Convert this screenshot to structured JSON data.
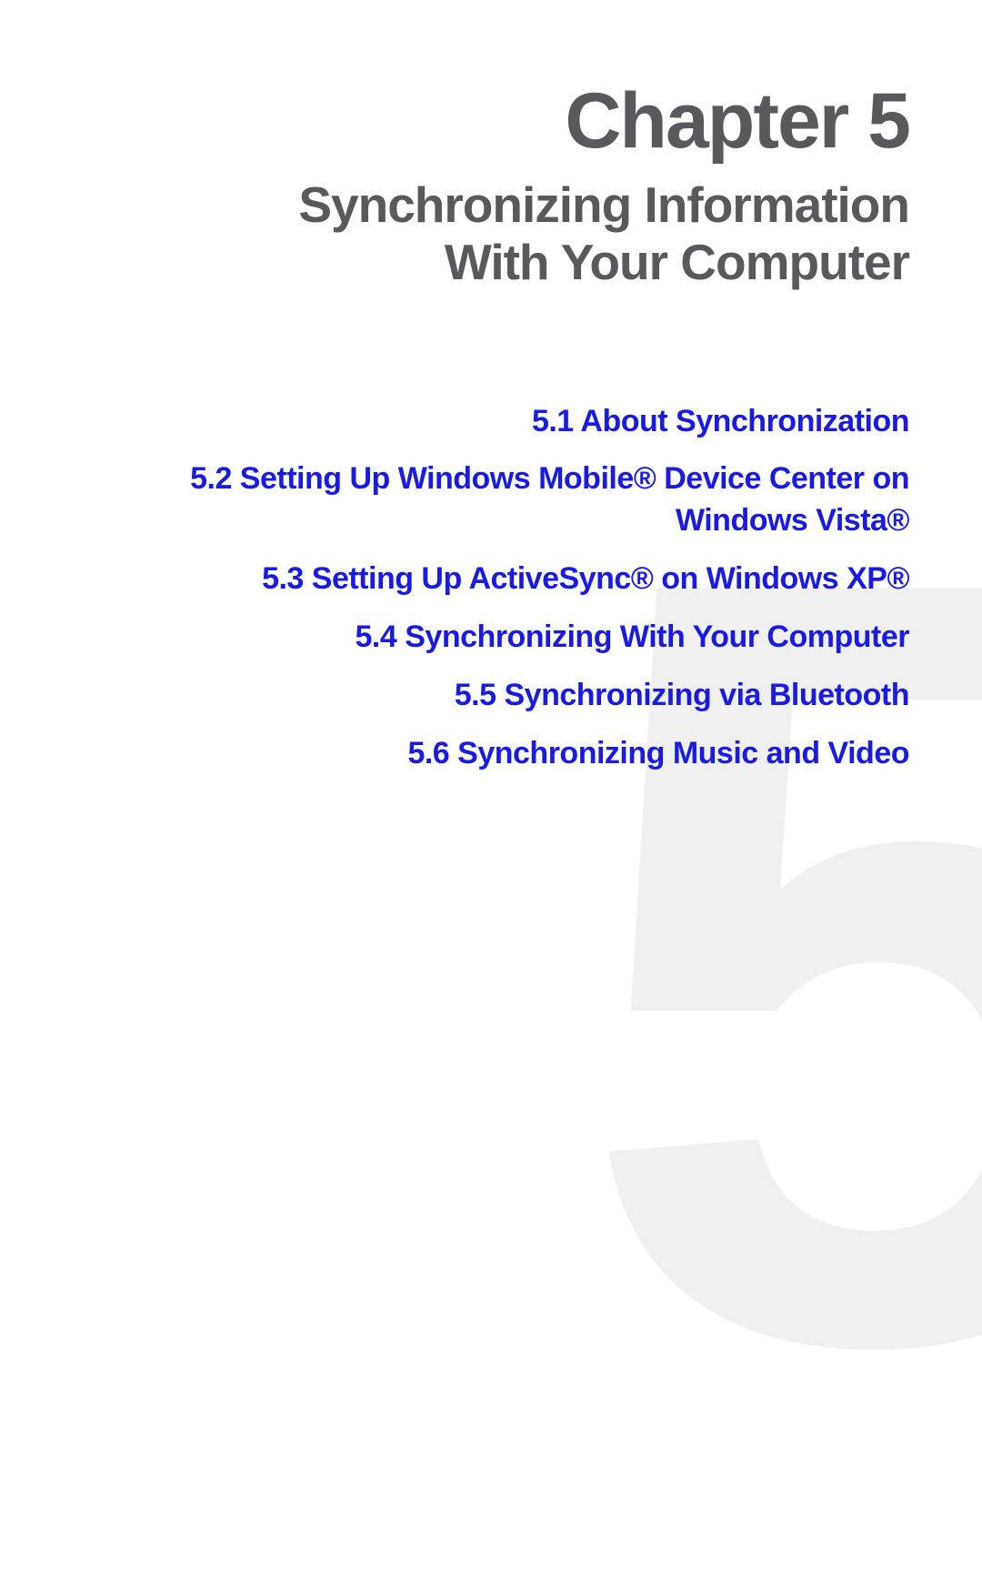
{
  "chapter": {
    "heading": "Chapter 5",
    "title_line1": "Synchronizing Information",
    "title_line2": "With Your Computer",
    "watermark": "5"
  },
  "toc": {
    "items": [
      {
        "label": "5.1  About Synchronization"
      },
      {
        "label": "5.2  Setting Up Windows Mobile® Device Center on Windows Vista®"
      },
      {
        "label": "5.3  Setting Up ActiveSync® on Windows XP®"
      },
      {
        "label": "5.4  Synchronizing With Your Computer"
      },
      {
        "label": "5.5  Synchronizing via Bluetooth"
      },
      {
        "label": "5.6  Synchronizing Music and Video"
      }
    ]
  }
}
